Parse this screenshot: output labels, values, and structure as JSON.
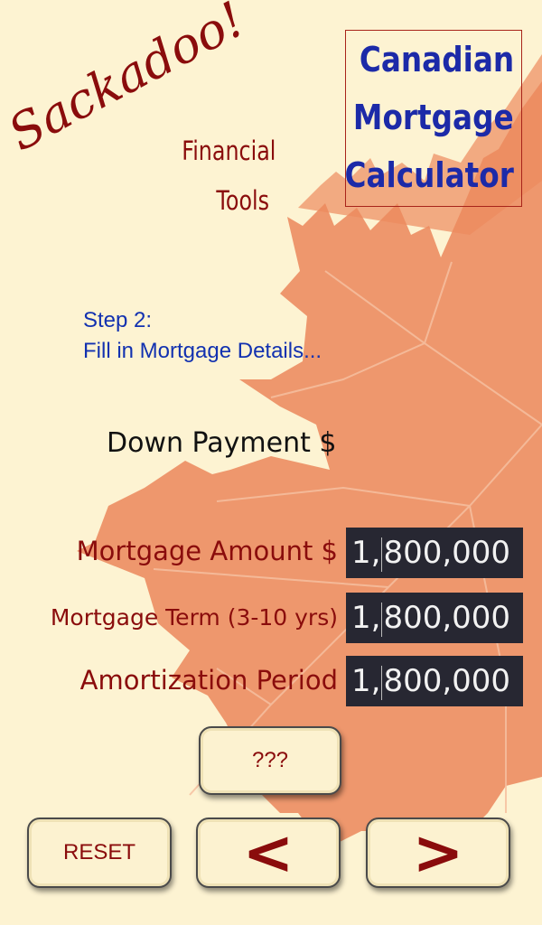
{
  "app": {
    "logo_text": "Sackadoo!",
    "tagline_line1": "Financial",
    "tagline_line2": "Tools",
    "title_line1": "Canadian",
    "title_line2": "Mortgage",
    "title_line3": "Calculator"
  },
  "step": {
    "line1": "Step 2:",
    "line2": "Fill in Mortgage Details..."
  },
  "form": {
    "down_payment_label": "Down Payment $",
    "mortgage_amount_label": "Mortgage Amount $",
    "mortgage_amount_value_a": "1,",
    "mortgage_amount_value_b": "800,000",
    "mortgage_term_label": "Mortgage Term (3-10 yrs)",
    "mortgage_term_value_a": "1,",
    "mortgage_term_value_b": "800,000",
    "amortization_label": "Amortization Period",
    "amortization_value_a": "1,",
    "amortization_value_b": "800,000"
  },
  "buttons": {
    "help_label": "???",
    "reset_label": "RESET",
    "prev_label": "<",
    "next_label": ">"
  },
  "colors": {
    "background": "#fdf3d2",
    "leaf": "#ec8a5e",
    "brand_red": "#8a0c0c",
    "title_blue": "#1c2aa8",
    "step_blue": "#1231b0",
    "field_bg": "#272732"
  }
}
